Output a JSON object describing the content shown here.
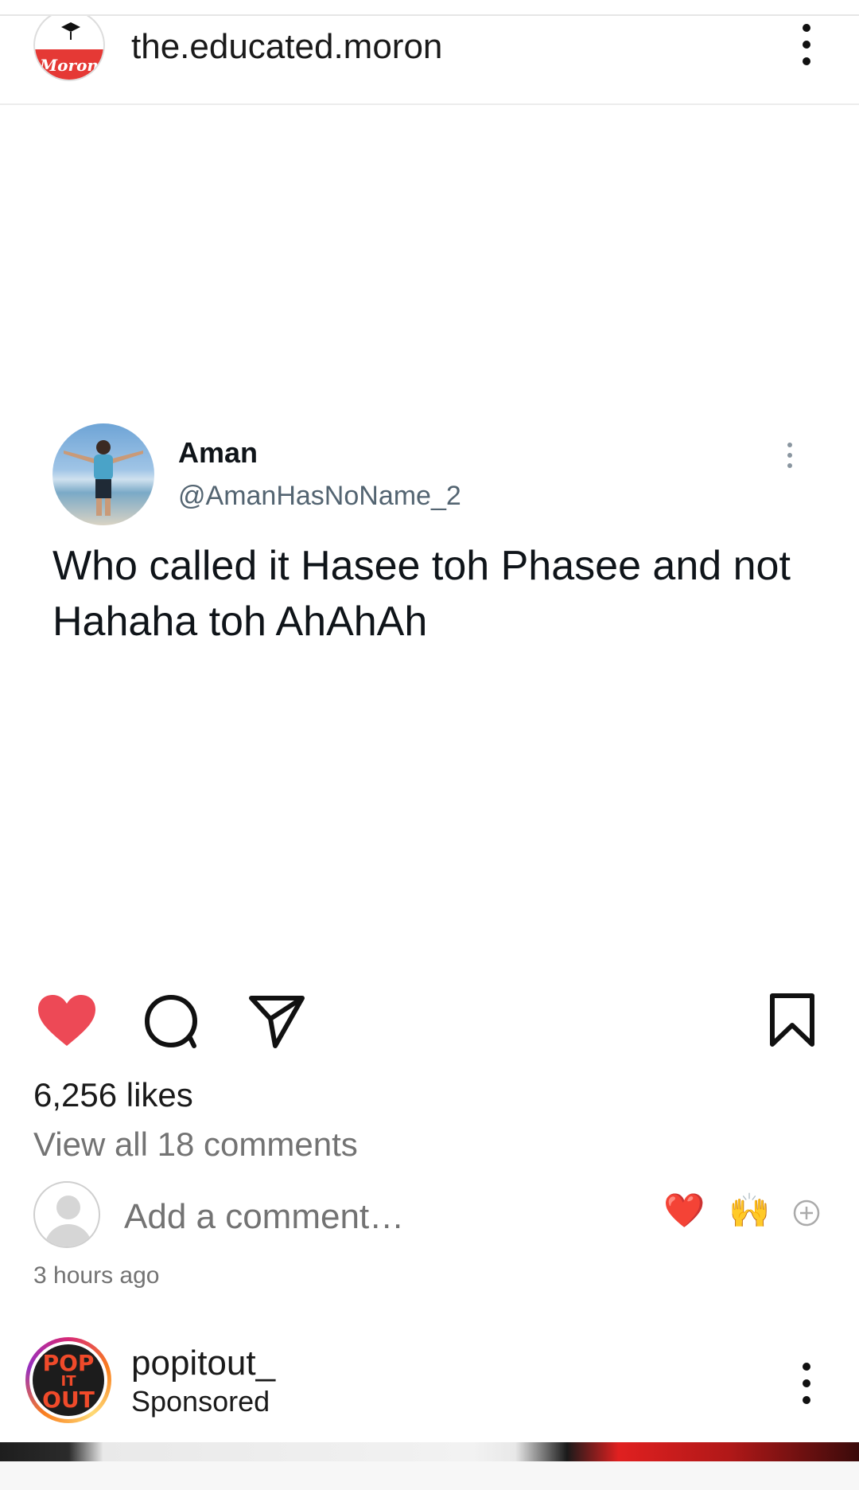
{
  "post": {
    "username": "the.educated.moron",
    "avatar_text": "Moron"
  },
  "tweet": {
    "name": "Aman",
    "handle": "@AmanHasNoName_2",
    "text": "Who called it Hasee toh Phasee and not Hahaha toh AhAhAh"
  },
  "actions": {
    "liked": true,
    "like_color": "#ed4956",
    "icons": [
      "heart-icon",
      "comment-icon",
      "share-icon",
      "bookmark-icon"
    ]
  },
  "stats": {
    "likes": "6,256 likes",
    "view_comments": "View all 18 comments"
  },
  "comment_box": {
    "placeholder": "Add a comment…",
    "quick_reactions": [
      "❤️",
      "🙌"
    ]
  },
  "timestamp": "3 hours ago",
  "next_post": {
    "username": "popitout_",
    "label": "Sponsored",
    "logo_lines": [
      "POP",
      "IT",
      "OUT"
    ]
  }
}
